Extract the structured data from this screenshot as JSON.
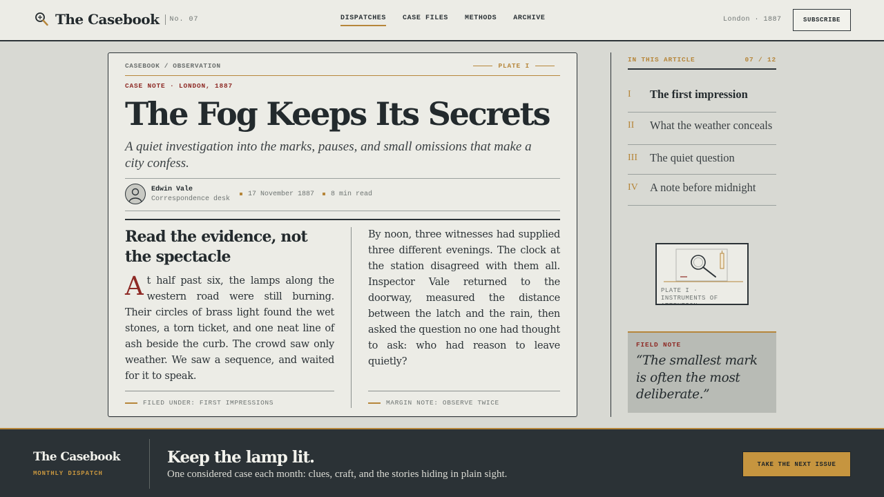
{
  "header": {
    "brand": "The Casebook",
    "issue": "No. 07",
    "nav": [
      {
        "label": "DISPATCHES",
        "active": true
      },
      {
        "label": "CASE FILES",
        "active": false
      },
      {
        "label": "METHODS",
        "active": false
      },
      {
        "label": "ARCHIVE",
        "active": false
      }
    ],
    "place": "London · 1887",
    "subscribe_label": "SUBSCRIBE"
  },
  "article": {
    "breadcrumb": "CASEBOOK / OBSERVATION",
    "plate_label": "PLATE I",
    "kicker": "CASE NOTE · LONDON, 1887",
    "title": "The Fog Keeps Its Secrets",
    "dek": "A quiet investigation into the marks, pauses, and small omissions that make a city confess.",
    "author": {
      "name": "Edwin Vale",
      "role": "Correspondence desk"
    },
    "date": "17 November 1887",
    "read_time": "8 min read",
    "section_heading": "Read the evidence, not the spectacle",
    "dropcap": "A",
    "left_body": "t half past six, the lamps along the western road were still burning. Their circles of brass light found the wet stones, a torn ticket, and one neat line of ash beside the curb. The crowd saw only weather. We saw a sequence, and waited for it to speak.",
    "right_body": "By noon, three witnesses had supplied three different evenings. The clock at the station disagreed with them all. Inspector Vale returned to the doorway, measured the distance between the latch and the rain, then asked the question no one had thought to ask: who had reason to leave quietly?",
    "filed_under": "FILED UNDER: FIRST IMPRESSIONS",
    "margin_note": "MARGIN NOTE: OBSERVE TWICE"
  },
  "sidebar": {
    "toc_title": "IN THIS ARTICLE",
    "toc_count": "07 / 12",
    "toc": [
      {
        "num": "I",
        "label": "The first impression",
        "active": true
      },
      {
        "num": "II",
        "label": "What the weather conceals",
        "active": false
      },
      {
        "num": "III",
        "label": "The quiet question",
        "active": false
      },
      {
        "num": "IV",
        "label": "A note before midnight",
        "active": false
      }
    ],
    "plate_caption": "PLATE I · INSTRUMENTS OF ATTENTION",
    "field_note_label": "FIELD NOTE",
    "field_note_quote": "“The smallest mark is often the most deliberate.”"
  },
  "footer": {
    "brand": "The Casebook",
    "subtitle": "MONTHLY DISPATCH",
    "title": "Keep the lamp lit.",
    "text": "One considered case each month: clues, craft, and the stories hiding in plain sight.",
    "button_label": "TAKE THE NEXT ISSUE"
  },
  "colors": {
    "ink": "#232a2d",
    "accent_gold": "#b6863a",
    "accent_red": "#8e2a25",
    "paper": "#ecece6",
    "background": "#d8d9d3",
    "footer": "#2b3236"
  }
}
